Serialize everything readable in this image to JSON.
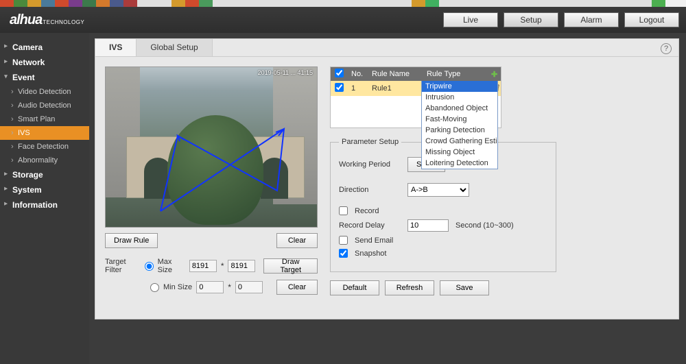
{
  "brand": {
    "name": "alhua",
    "sub": "TECHNOLOGY"
  },
  "nav": {
    "live": "Live",
    "setup": "Setup",
    "alarm": "Alarm",
    "logout": "Logout"
  },
  "sidebar": {
    "camera": "Camera",
    "network": "Network",
    "event": "Event",
    "event_items": {
      "video_detection": "Video Detection",
      "audio_detection": "Audio Detection",
      "smart_plan": "Smart Plan",
      "ivs": "IVS",
      "face_detection": "Face Detection",
      "abnormality": "Abnormality"
    },
    "storage": "Storage",
    "system": "System",
    "information": "Information"
  },
  "tabs": {
    "ivs": "IVS",
    "global": "Global Setup"
  },
  "video": {
    "timestamp": "2019-05-11 ... 41:15"
  },
  "left": {
    "draw_rule": "Draw Rule",
    "clear": "Clear",
    "target_filter": "Target Filter",
    "max_size": "Max Size",
    "min_size": "Min Size",
    "max_w": "8191",
    "max_h": "8191",
    "min_w": "0",
    "min_h": "0",
    "draw_target": "Draw Target"
  },
  "rules": {
    "chk": "✔",
    "no": "No.",
    "name": "Rule Name",
    "type": "Rule Type",
    "row_no": "1",
    "row_name": "Rule1",
    "row_type_selected": "Tripwire",
    "options": [
      "Tripwire",
      "Intrusion",
      "Abandoned Object",
      "Fast-Moving",
      "Parking Detection",
      "Crowd Gathering Estimation",
      "Missing Object",
      "Loitering Detection"
    ]
  },
  "param": {
    "legend": "Parameter Setup",
    "working_period": "Working Period",
    "setup": "Setup",
    "direction": "Direction",
    "direction_value": "A->B",
    "record": "Record",
    "record_delay": "Record Delay",
    "record_delay_value": "10",
    "record_delay_hint": "Second (10~300)",
    "send_email": "Send Email",
    "snapshot": "Snapshot"
  },
  "actions": {
    "default": "Default",
    "refresh": "Refresh",
    "save": "Save"
  },
  "help": "?"
}
